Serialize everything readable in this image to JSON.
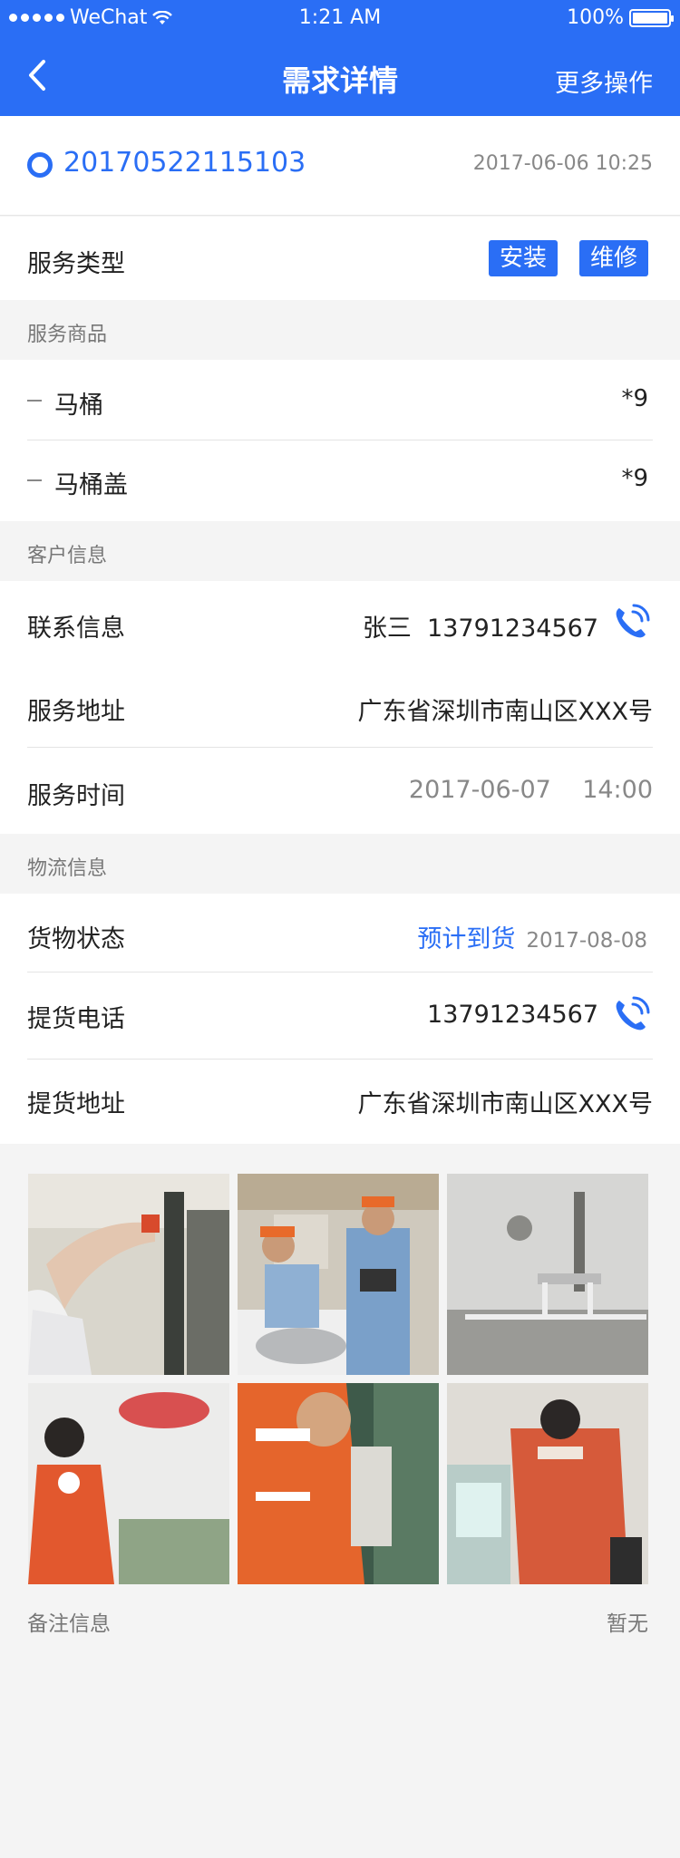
{
  "status_bar": {
    "carrier": "WeChat",
    "time": "1:21 AM",
    "battery": "100%"
  },
  "nav": {
    "title": "需求详情",
    "more_label": "更多操作"
  },
  "order": {
    "number": "20170522115103",
    "datetime": "2017-06-06 10:25"
  },
  "service_type": {
    "label": "服务类型",
    "tags": [
      "安装",
      "维修"
    ]
  },
  "sections": {
    "products": "服务商品",
    "customer": "客户信息",
    "logistics": "物流信息"
  },
  "products": [
    {
      "name": "马桶",
      "qty": "*9"
    },
    {
      "name": "马桶盖",
      "qty": "*9"
    }
  ],
  "customer": {
    "contact_label": "联系信息",
    "contact_name": "张三",
    "contact_phone": "13791234567",
    "address_label": "服务地址",
    "address": "广东省深圳市南山区XXX号",
    "time_label": "服务时间",
    "date": "2017-06-07",
    "time": "14:00"
  },
  "logistics": {
    "status_label": "货物状态",
    "status": "预计到货",
    "status_date": "2017-08-08",
    "phone_label": "提货电话",
    "phone": "13791234567",
    "address_label": "提货地址",
    "address": "广东省深圳市南山区XXX号"
  },
  "photos": [
    {
      "name": "photo-1"
    },
    {
      "name": "photo-2"
    },
    {
      "name": "photo-3"
    },
    {
      "name": "photo-4"
    },
    {
      "name": "photo-5"
    },
    {
      "name": "photo-6"
    }
  ],
  "remarks": {
    "label": "备注信息",
    "value": "暂无"
  },
  "colors": {
    "primary": "#2a6ef5",
    "background": "#f4f4f4"
  }
}
